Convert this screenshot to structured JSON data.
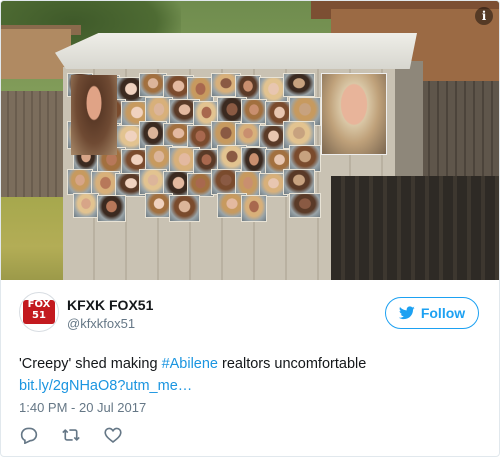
{
  "media": {
    "info_icon": "info-icon",
    "info_glyph": "i"
  },
  "author": {
    "avatar_text_line1": "FOX",
    "avatar_text_line2": "51",
    "name": "KFXK FOX51",
    "handle": "@kfxkfox51"
  },
  "follow": {
    "label": "Follow",
    "icon": "twitter-bird-icon",
    "color": "#1da1f2"
  },
  "tweet": {
    "text_before": "'Creepy' shed making ",
    "hashtag": "#Abilene",
    "text_after": " realtors uncomfortable",
    "link": "bit.ly/2gNHaO8?utm_me…",
    "timestamp": "1:40 PM - 20 Jul 2017",
    "link_color": "#1b95e0"
  },
  "actions": [
    {
      "icon": "reply-icon"
    },
    {
      "icon": "retweet-icon"
    },
    {
      "icon": "like-icon"
    }
  ]
}
